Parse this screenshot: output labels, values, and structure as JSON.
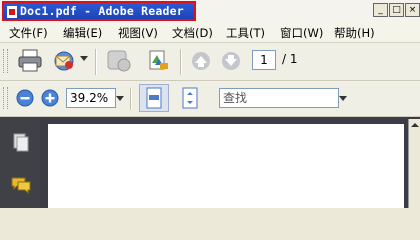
{
  "window": {
    "title": "Doc1.pdf - Adobe Reader",
    "controls": {
      "minimize": "_",
      "maximize": "□",
      "close": "×"
    }
  },
  "menu": [
    {
      "label": "文件(F)"
    },
    {
      "label": "编辑(E)"
    },
    {
      "label": "视图(V)"
    },
    {
      "label": "文档(D)"
    },
    {
      "label": "工具(T)"
    },
    {
      "label": "窗口(W)"
    },
    {
      "label": "帮助(H)"
    }
  ],
  "toolbar": {
    "page_current": "1",
    "page_total": "/ 1",
    "zoom_value": "39.2%",
    "find_placeholder": "查找"
  },
  "colors": {
    "title_bar": "#2b5ad6",
    "highlight_border": "#e0101a",
    "content_bg": "#3c3d44",
    "nav_pane_bg": "#404147"
  }
}
